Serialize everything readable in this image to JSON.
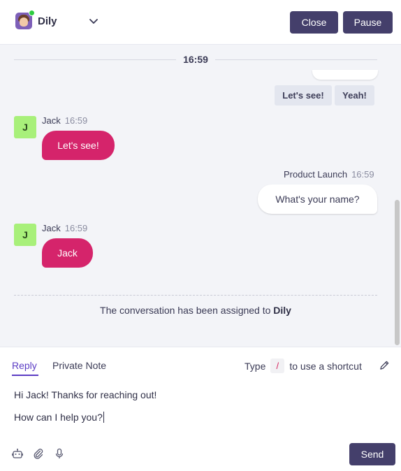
{
  "header": {
    "agent_name": "Dily",
    "close_label": "Close",
    "pause_label": "Pause",
    "accent": "#443f6b"
  },
  "messages": {
    "time_divider": "16:59",
    "quick_replies": [
      "Let's see!",
      "Yeah!"
    ],
    "items": [
      {
        "author_initial": "J",
        "author": "Jack",
        "time": "16:59",
        "text": "Let's see!",
        "direction": "incoming"
      },
      {
        "author": "Product Launch",
        "time": "16:59",
        "text": "What's your name?",
        "direction": "outgoing"
      },
      {
        "author_initial": "J",
        "author": "Jack",
        "time": "16:59",
        "text": "Jack",
        "direction": "incoming"
      }
    ],
    "assignment_prefix": "The conversation has been assigned to",
    "assignment_name": "Dily",
    "incoming_color": "#d5246b"
  },
  "composer": {
    "tab_reply": "Reply",
    "tab_note": "Private Note",
    "shortcut_prefix": "Type",
    "shortcut_key": "/",
    "shortcut_suffix": "to use a shortcut",
    "lines": [
      "Hi Jack! Thanks for reaching out!",
      "How can I help you?"
    ],
    "send_label": "Send",
    "tab_active_color": "#5b3cc4"
  }
}
